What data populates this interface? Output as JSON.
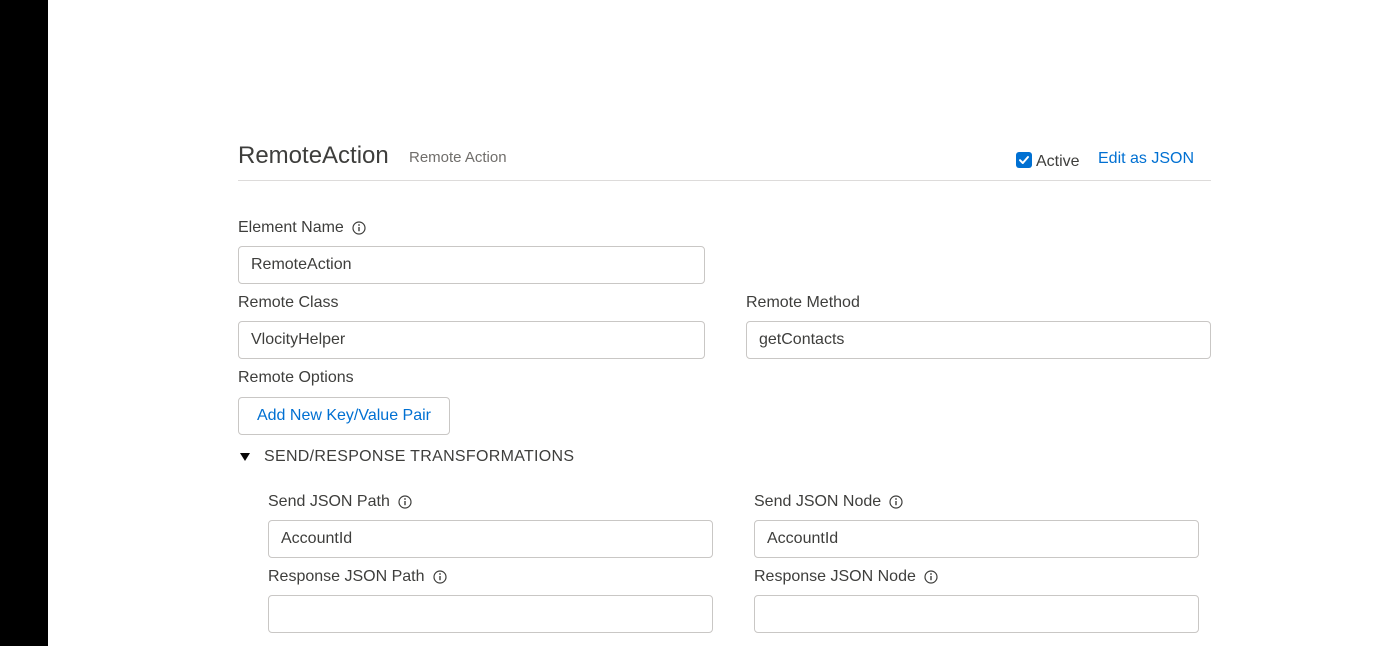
{
  "header": {
    "title": "RemoteAction",
    "subtitle": "Remote Action",
    "active_label": "Active",
    "edit_json_label": "Edit as JSON"
  },
  "form": {
    "element_name": {
      "label": "Element Name",
      "value": "RemoteAction"
    },
    "remote_class": {
      "label": "Remote Class",
      "value": "VlocityHelper"
    },
    "remote_method": {
      "label": "Remote Method",
      "value": "getContacts"
    },
    "remote_options": {
      "label": "Remote Options",
      "button_label": "Add New Key/Value Pair"
    }
  },
  "transformations": {
    "section_title": "SEND/RESPONSE TRANSFORMATIONS",
    "send_json_path": {
      "label": "Send JSON Path",
      "value": "AccountId"
    },
    "send_json_node": {
      "label": "Send JSON Node",
      "value": "AccountId"
    },
    "response_json_path": {
      "label": "Response JSON Path",
      "value": ""
    },
    "response_json_node": {
      "label": "Response JSON Node",
      "value": ""
    }
  },
  "colors": {
    "link": "#0070d2",
    "border": "#c9c7c5",
    "text": "#3e3e3c",
    "left_strip": "#000000"
  },
  "icons": [
    "info-icon",
    "checkbox-checked-icon",
    "caret-down-icon"
  ]
}
